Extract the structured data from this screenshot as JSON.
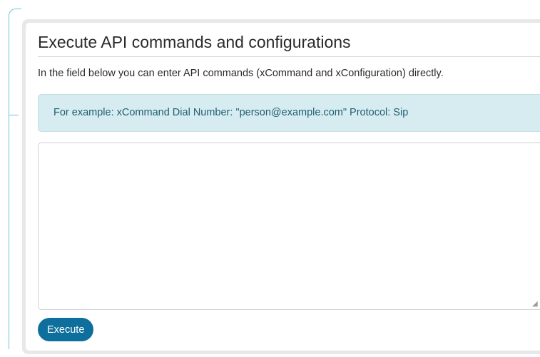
{
  "panel": {
    "title": "Execute API commands and configurations",
    "description": "In the field below you can enter API commands (xCommand and xConfiguration) directly.",
    "example": "For example: xCommand Dial Number: \"person@example.com\" Protocol: Sip",
    "command_input": {
      "value": "",
      "placeholder": ""
    },
    "execute_label": "Execute"
  },
  "icons": {
    "resize_grip": "resize-grip-icon"
  },
  "colors": {
    "accent": "#0e6f9c",
    "info_background": "#d6ecf1",
    "info_text": "#1f5e72",
    "callout_line": "#6cc3e3"
  }
}
